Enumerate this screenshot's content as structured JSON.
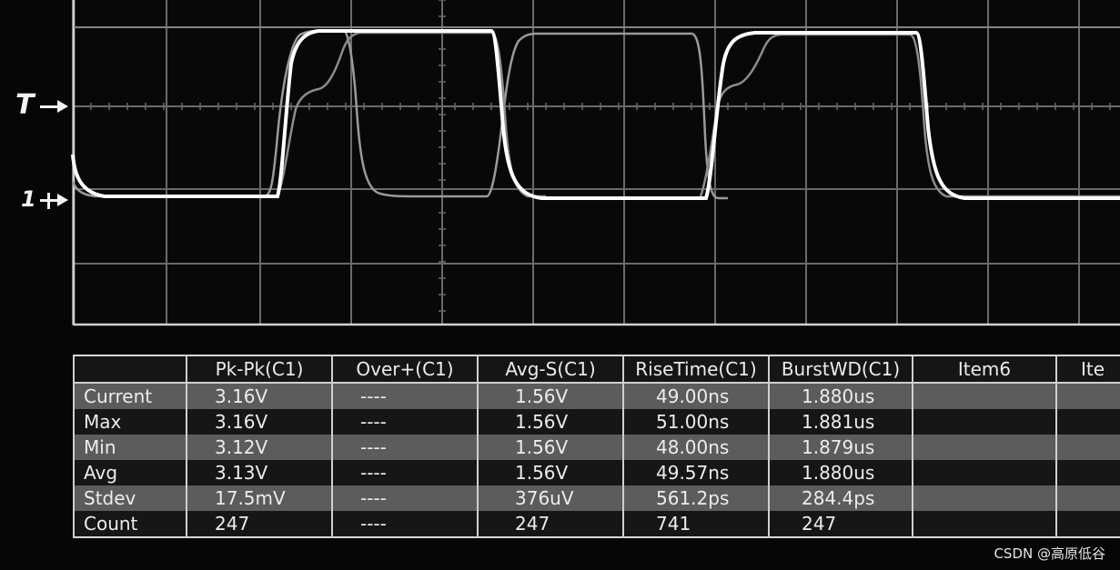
{
  "markers": {
    "trigger": "T",
    "channel1": "1"
  },
  "table": {
    "headers": [
      "",
      "Pk-Pk(C1)",
      "Over+(C1)",
      "Avg-S(C1)",
      "RiseTime(C1)",
      "BurstWD(C1)",
      "Item6",
      "Ite"
    ],
    "rows": [
      {
        "label": "Current",
        "values": [
          "3.16V",
          "----",
          "1.56V",
          "49.00ns",
          "1.880us",
          "",
          ""
        ]
      },
      {
        "label": "Max",
        "values": [
          "3.16V",
          "----",
          "1.56V",
          "51.00ns",
          "1.881us",
          "",
          ""
        ]
      },
      {
        "label": "Min",
        "values": [
          "3.12V",
          "----",
          "1.56V",
          "48.00ns",
          "1.879us",
          "",
          ""
        ]
      },
      {
        "label": "Avg",
        "values": [
          "3.13V",
          "----",
          "1.56V",
          "49.57ns",
          "1.880us",
          "",
          ""
        ]
      },
      {
        "label": "Stdev",
        "values": [
          "17.5mV",
          "----",
          "376uV",
          "561.2ps",
          "284.4ps",
          "",
          ""
        ]
      },
      {
        "label": "Count",
        "values": [
          "247",
          "----",
          "247",
          "741",
          "247",
          "",
          ""
        ]
      }
    ]
  },
  "watermark": "CSDN @高原低谷",
  "colors": {
    "background": "#060606",
    "grid": "#6a6a6a",
    "trace_main": "#ffffff",
    "trace_ghost": "#9a9a9a",
    "row_shade": "#5c5c5c",
    "row_dark": "#161616"
  }
}
